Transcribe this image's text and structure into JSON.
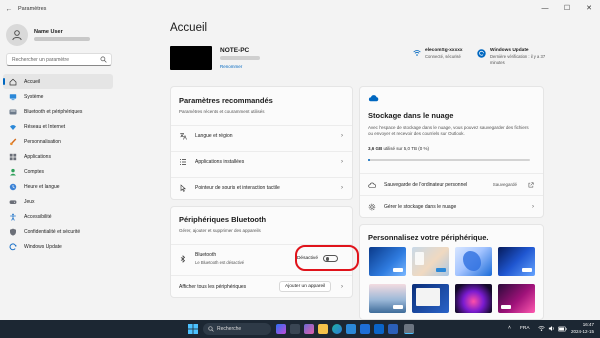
{
  "window": {
    "title": "Paramètres",
    "back_glyph": "←",
    "min_glyph": "—",
    "max_glyph": "☐",
    "close_glyph": "✕"
  },
  "profile": {
    "name": "Name User"
  },
  "search": {
    "placeholder": "Rechercher un paramètre"
  },
  "nav": [
    {
      "label": "Accueil",
      "icon": "home-icon",
      "active": true
    },
    {
      "label": "Système",
      "icon": "system-icon"
    },
    {
      "label": "Bluetooth et périphériques",
      "icon": "bluetooth-icon"
    },
    {
      "label": "Réseau et Internet",
      "icon": "network-icon"
    },
    {
      "label": "Personnalisation",
      "icon": "personalization-icon"
    },
    {
      "label": "Applications",
      "icon": "apps-icon"
    },
    {
      "label": "Comptes",
      "icon": "accounts-icon"
    },
    {
      "label": "Heure et langue",
      "icon": "time-language-icon"
    },
    {
      "label": "Jeux",
      "icon": "gaming-icon"
    },
    {
      "label": "Accessibilité",
      "icon": "accessibility-icon"
    },
    {
      "label": "Confidentialité et sécurité",
      "icon": "privacy-icon"
    },
    {
      "label": "Windows Update",
      "icon": "windows-update-icon"
    }
  ],
  "main": {
    "title": "Accueil",
    "device": {
      "name": "NOTE-PC",
      "rename": "Renommer"
    },
    "wifi": {
      "name": "elecomSg-xxxxx",
      "status": "Connecté, sécurisé"
    },
    "update": {
      "title": "Windows Update",
      "status": "Dernière vérification : il y a 37 minutes"
    }
  },
  "recommended": {
    "title": "Paramètres recommandés",
    "subtitle": "Paramètres récents et couramment utilisés",
    "items": [
      {
        "label": "Langue et région",
        "icon": "language-icon"
      },
      {
        "label": "Applications installées",
        "icon": "installed-apps-icon"
      },
      {
        "label": "Pointeur de souris et interaction tactile",
        "icon": "mouse-pointer-icon"
      }
    ]
  },
  "bluetooth": {
    "title": "Périphériques Bluetooth",
    "subtitle": "Gérer, ajouter et supprimer des appareils",
    "device_name": "Bluetooth",
    "device_status": "Le Bluetooth est désactivé",
    "toggle_label": "Désactivé",
    "toggle_on": false,
    "view_all": "Afficher tous les périphériques",
    "add_device": "Ajouter un appareil"
  },
  "cloud": {
    "title": "Stockage dans le nuage",
    "description": "Avec l'espace de stockage dans le nuage, vous pouvez sauvegarder des fichiers ou envoyer et recevoir des courriels sur Outlook.",
    "usage_value": "3,6 GB",
    "usage_text": "utilisé sur 5,0 TB (0 %)",
    "usage_fraction": 0.002,
    "backup_label": "Sauvegarde de l'ordinateur personnel",
    "backup_status": "Sauvegardé",
    "manage_label": "Gérer le stockage dans le nuage"
  },
  "personalize": {
    "title": "Personnalisez votre périphérique."
  },
  "taskbar": {
    "search_label": "Recherche",
    "language": "FRA",
    "time": "16:47",
    "date": "2024-12-15"
  },
  "colors": {
    "accent": "#0067c0",
    "highlight": "#e0131b",
    "taskbar": "#1c2733"
  }
}
